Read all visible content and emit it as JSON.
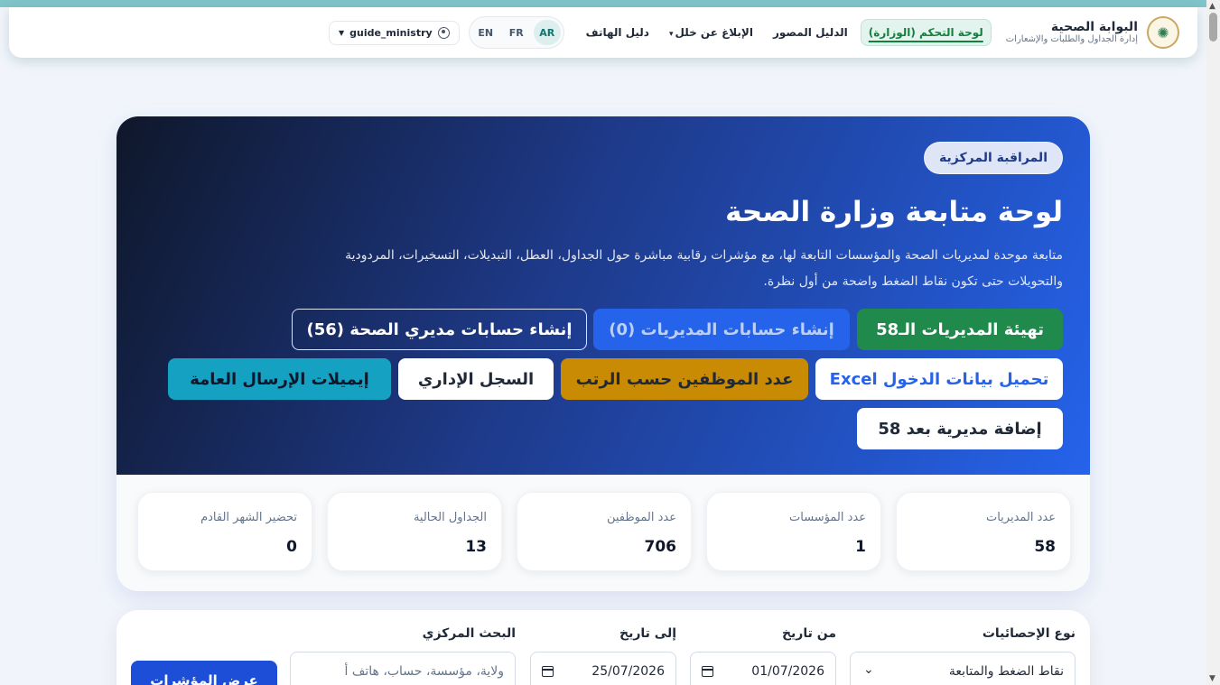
{
  "brand": {
    "title": "البوابة الصحية",
    "subtitle": "إدارة الجداول والطلبات والإشعارات",
    "logo_icon": "emblem-icon"
  },
  "nav": {
    "items": [
      {
        "label": "لوحة التحكم (الوزارة)",
        "active": true
      },
      {
        "label": "الدليل المصور",
        "active": false
      },
      {
        "label": "الإبلاغ عن خلل",
        "active": false,
        "dropdown": true
      },
      {
        "label": "دليل الهاتف",
        "active": false
      }
    ],
    "languages": [
      {
        "code": "AR",
        "active": true
      },
      {
        "code": "FR",
        "active": false
      },
      {
        "code": "EN",
        "active": false
      }
    ],
    "user": "guide_ministry"
  },
  "hero": {
    "badge": "المراقبة المركزية",
    "title": "لوحة متابعة وزارة الصحة",
    "description": "متابعة موحدة لمديريات الصحة والمؤسسات التابعة لها، مع مؤشرات رقابية مباشرة حول الجداول، العطل، التبديلات، التسخيرات، المردودية والتحويلات حتى تكون نقاط الضغط واضحة من أول نظرة.",
    "buttons": {
      "setup_directorates": "تهيئة المديريات الـ58",
      "create_directorate_accounts": "إنشاء حسابات المديريات (0)",
      "create_director_accounts": "إنشاء حسابات مديري الصحة (56)",
      "upload_login_excel": "تحميل بيانات الدخول Excel",
      "staff_by_rank": "عدد الموظفين حسب الرتب",
      "admin_log": "السجل الإداري",
      "general_emails": "إيميلات الإرسال العامة",
      "add_directorate": "إضافة مديرية بعد 58"
    }
  },
  "stats": [
    {
      "label": "عدد المديريات",
      "value": "58"
    },
    {
      "label": "عدد المؤسسات",
      "value": "1"
    },
    {
      "label": "عدد الموظفين",
      "value": "706"
    },
    {
      "label": "الجداول الحالية",
      "value": "13"
    },
    {
      "label": "تحضير الشهر القادم",
      "value": "0"
    }
  ],
  "filters": {
    "stat_type_label": "نوع الإحصائيات",
    "stat_type_value": "نقاط الضغط والمتابعة",
    "from_label": "من تاريخ",
    "from_value": "01/07/2026",
    "to_label": "إلى تاريخ",
    "to_value": "25/07/2026",
    "search_label": "البحث المركزي",
    "search_placeholder": "ولاية، مؤسسة، حساب، هاتف أ",
    "submit": "عرض المؤشرات"
  },
  "colors": {
    "accent_green": "#1f8a4c",
    "accent_blue": "#2563eb",
    "hero_dark": "#0f172a",
    "amber": "#c98a04",
    "teal": "#15a2c2"
  }
}
